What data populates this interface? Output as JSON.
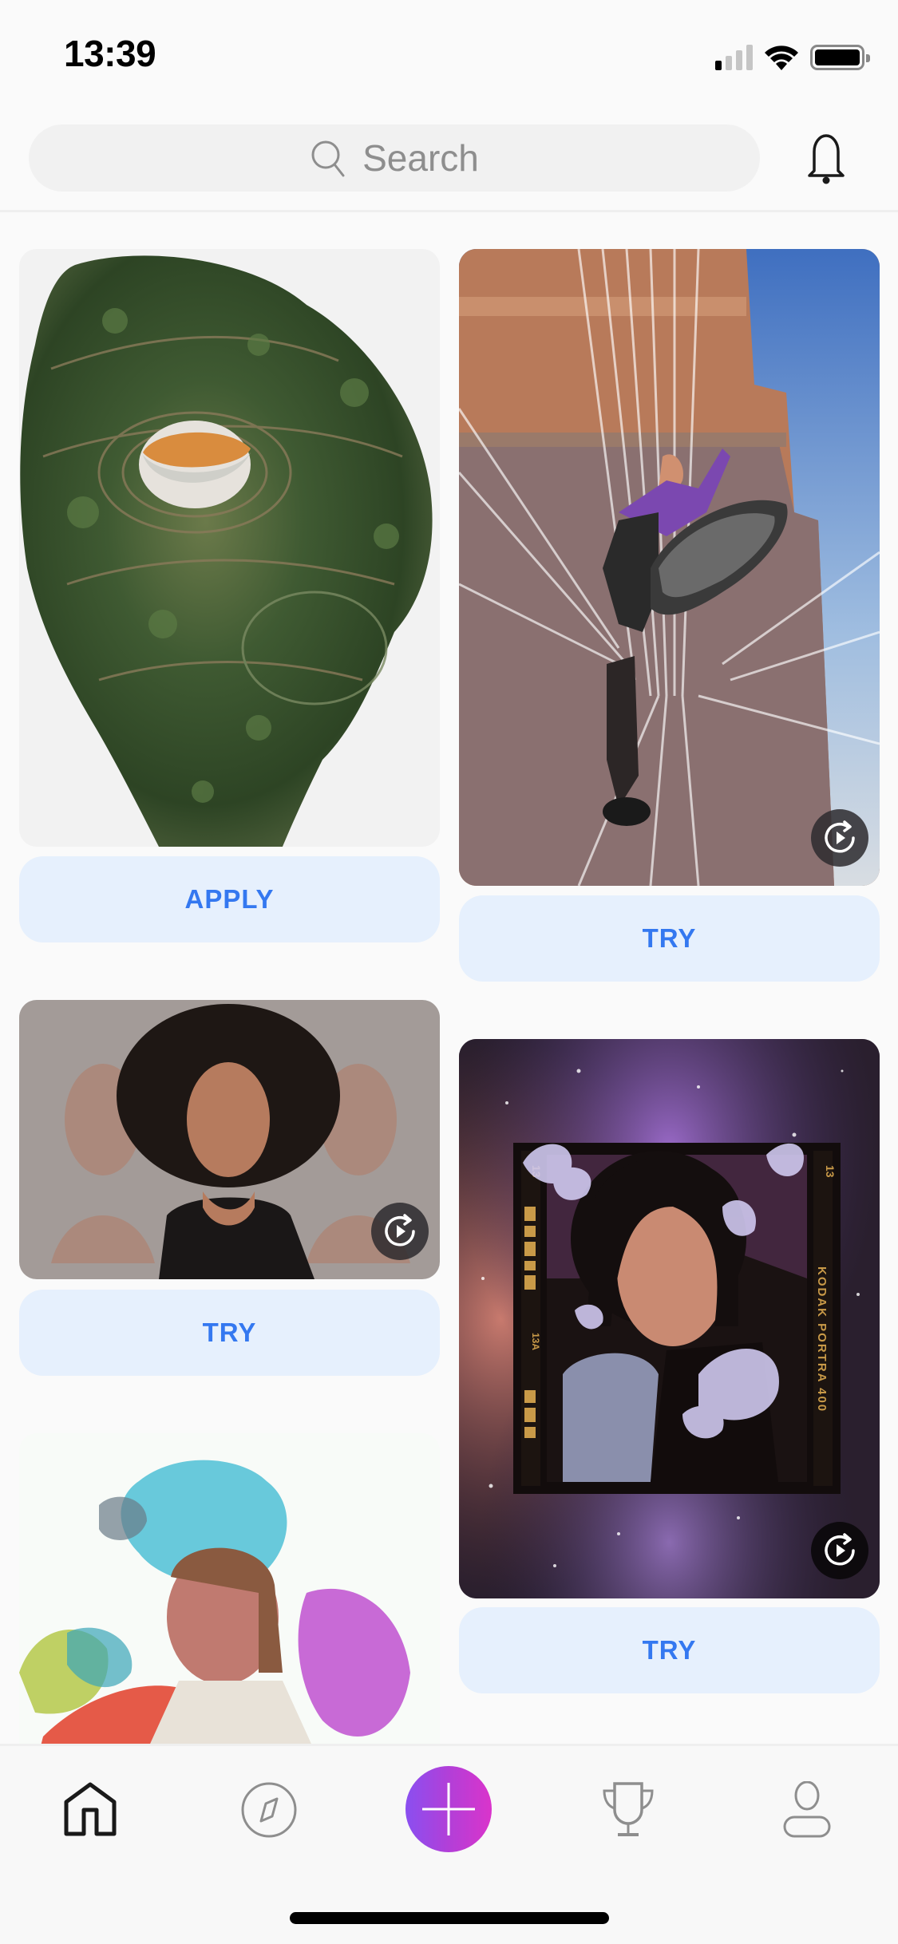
{
  "status_bar": {
    "time": "13:39",
    "signal_bars_active": 1,
    "signal_bars_total": 4,
    "wifi": "wifi-icon",
    "battery": "battery-icon"
  },
  "header": {
    "search_placeholder": "Search",
    "search_icon": "search-icon",
    "notifications_icon": "bell-icon"
  },
  "feed": {
    "left_column": [
      {
        "id": "swirl-bird",
        "image_desc": "Twirl-effect cutout of a robin among branches",
        "action_label": "APPLY",
        "has_replay": false
      },
      {
        "id": "echo-portrait",
        "image_desc": "Woman with curly hair with faded echo duplicates",
        "action_label": "TRY",
        "has_replay": true
      },
      {
        "id": "color-powder",
        "image_desc": "Woman covered in colorful holi powder explosion",
        "action_label": null,
        "has_replay": false
      }
    ],
    "right_column": [
      {
        "id": "plastic-wrap",
        "image_desc": "Woman kicking with plastic wrap overlay in front of building",
        "action_label": "TRY",
        "has_replay": true
      },
      {
        "id": "galaxy-film",
        "image_desc": "Portrait in film frame with butterflies on galaxy background",
        "film_text": [
          "13",
          "13",
          "13A",
          "KODAK PORTRA 400"
        ],
        "action_label": "TRY",
        "has_replay": true
      }
    ]
  },
  "tab_bar": {
    "items": [
      {
        "name": "home",
        "icon": "home-icon",
        "active": true
      },
      {
        "name": "discover",
        "icon": "compass-icon",
        "active": false
      },
      {
        "name": "create",
        "icon": "plus-icon",
        "active": false
      },
      {
        "name": "challenges",
        "icon": "trophy-icon",
        "active": false
      },
      {
        "name": "profile",
        "icon": "profile-icon",
        "active": false
      }
    ]
  },
  "colors": {
    "accent_blue": "#3478f0",
    "button_bg": "#e6f0fd",
    "create_gradient_start": "#8a4ff0",
    "create_gradient_end": "#da34cb",
    "background": "#fafafa"
  }
}
